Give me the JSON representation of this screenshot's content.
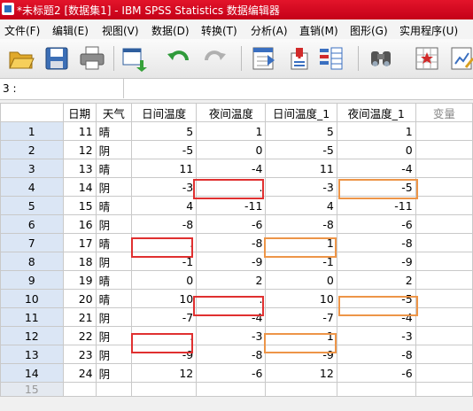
{
  "window": {
    "title": "*未标题2 [数据集1] - IBM SPSS Statistics 数据编辑器"
  },
  "menu": [
    "文件(F)",
    "编辑(E)",
    "视图(V)",
    "数据(D)",
    "转换(T)",
    "分析(A)",
    "直销(M)",
    "图形(G)",
    "实用程序(U)"
  ],
  "toolbar": {
    "icons": [
      "open-folder-icon",
      "save-icon",
      "print-icon",
      "dialog-recall-icon",
      "undo-icon",
      "redo-icon",
      "goto-case-icon",
      "goto-variable-icon",
      "variables-icon",
      "find-icon",
      "insert-cases-icon",
      "split-file-icon"
    ]
  },
  "cell_ref": {
    "label": "3 :",
    "value": ""
  },
  "columns": [
    "日期",
    "天气",
    "日间温度",
    "夜间温度",
    "日间温度_1",
    "夜间温度_1",
    "变量"
  ],
  "rows": [
    {
      "n": "1",
      "date": "11",
      "weather": "晴",
      "day": "5",
      "night": "1",
      "day1": "5",
      "night1": "1"
    },
    {
      "n": "2",
      "date": "12",
      "weather": "阴",
      "day": "-5",
      "night": "0",
      "day1": "-5",
      "night1": "0"
    },
    {
      "n": "3",
      "date": "13",
      "weather": "晴",
      "day": "11",
      "night": "-4",
      "day1": "11",
      "night1": "-4"
    },
    {
      "n": "4",
      "date": "14",
      "weather": "阴",
      "day": "-3",
      "night": ".",
      "day1": "-3",
      "night1": "-5"
    },
    {
      "n": "5",
      "date": "15",
      "weather": "晴",
      "day": "4",
      "night": "-11",
      "day1": "4",
      "night1": "-11"
    },
    {
      "n": "6",
      "date": "16",
      "weather": "阴",
      "day": "-8",
      "night": "-6",
      "day1": "-8",
      "night1": "-6"
    },
    {
      "n": "7",
      "date": "17",
      "weather": "晴",
      "day": ".",
      "night": "-8",
      "day1": "1",
      "night1": "-8"
    },
    {
      "n": "8",
      "date": "18",
      "weather": "阴",
      "day": "-1",
      "night": "-9",
      "day1": "-1",
      "night1": "-9"
    },
    {
      "n": "9",
      "date": "19",
      "weather": "晴",
      "day": "0",
      "night": "2",
      "day1": "0",
      "night1": "2"
    },
    {
      "n": "10",
      "date": "20",
      "weather": "晴",
      "day": "10",
      "night": ".",
      "day1": "10",
      "night1": "-5"
    },
    {
      "n": "11",
      "date": "21",
      "weather": "阴",
      "day": "-7",
      "night": "-4",
      "day1": "-7",
      "night1": "-4"
    },
    {
      "n": "12",
      "date": "22",
      "weather": "阴",
      "day": ".",
      "night": "-3",
      "day1": "1",
      "night1": "-3"
    },
    {
      "n": "13",
      "date": "23",
      "weather": "阴",
      "day": "-9",
      "night": "-8",
      "day1": "-9",
      "night1": "-8"
    },
    {
      "n": "14",
      "date": "24",
      "weather": "阴",
      "day": "12",
      "night": "-6",
      "day1": "12",
      "night1": "-6"
    }
  ],
  "empty_row": "15",
  "colors": {
    "title_bar": "#d0001a",
    "row_header": "#dbe6f5",
    "missing_highlight": "#e03030",
    "imputed_highlight": "#ed9548"
  }
}
